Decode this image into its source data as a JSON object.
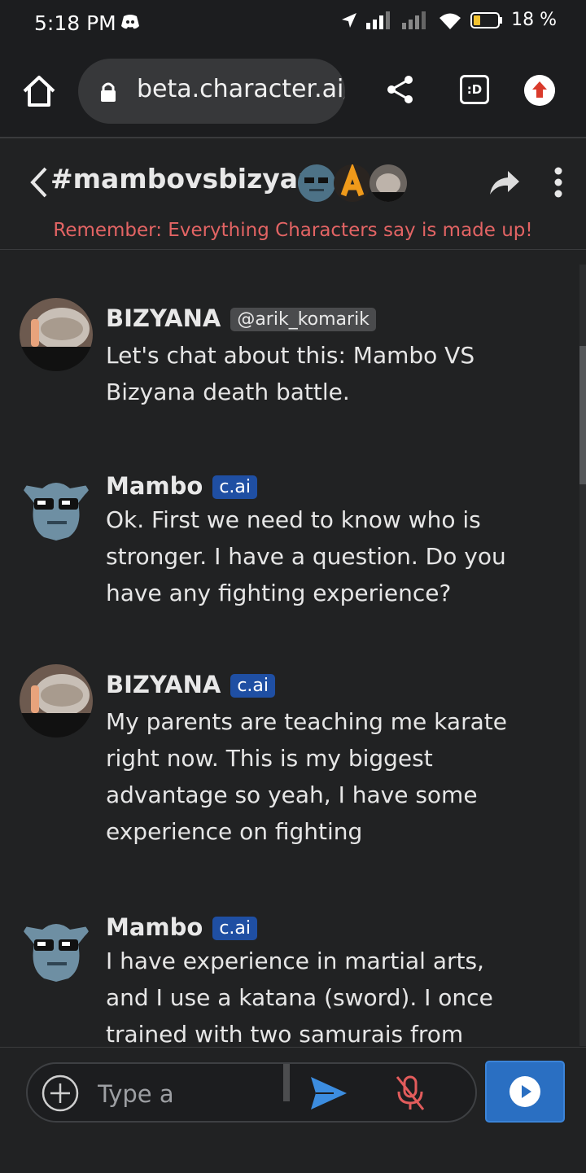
{
  "status_bar": {
    "time": "5:18 PM",
    "battery": "18 %"
  },
  "browser": {
    "url": "beta.character.ai/",
    "tabs_badge": ":D"
  },
  "chat": {
    "room_title": "#mambovsbizyana",
    "disclaimer": "Remember: Everything Characters say is made up!",
    "messages": [
      {
        "sender": "BIZYANA",
        "badge": "@arik_komarik",
        "text": "Let's chat about this: Mambo VS Bizyana death battle."
      },
      {
        "sender": "Mambo",
        "badge": "c.ai",
        "text": "Ok. First we need to know who is stronger. I have a question. Do you have any fighting experience?"
      },
      {
        "sender": "BIZYANA",
        "badge": "c.ai",
        "text": "My parents are teaching me karate right now. This is my biggest advantage so yeah, I have some experience on fighting"
      },
      {
        "sender": "Mambo",
        "badge": "c.ai",
        "text": "I have experience in martial arts, and I use a katana (sword). I once trained with two samurais from"
      }
    ]
  },
  "composer": {
    "placeholder": "Type a"
  },
  "icons": {
    "home": "home-icon",
    "lock": "lock-icon",
    "share": "share-icon",
    "upload": "upload-icon",
    "back": "back-icon",
    "more": "more-vert-icon",
    "plus": "plus-icon",
    "send": "send-icon",
    "mic": "mic-muted-icon",
    "play": "play-icon"
  },
  "colors": {
    "accent": "#2a6fc2",
    "badge_cai": "#1f4fa3",
    "disclaimer": "#e36464",
    "mic_muted": "#e25c5c"
  }
}
